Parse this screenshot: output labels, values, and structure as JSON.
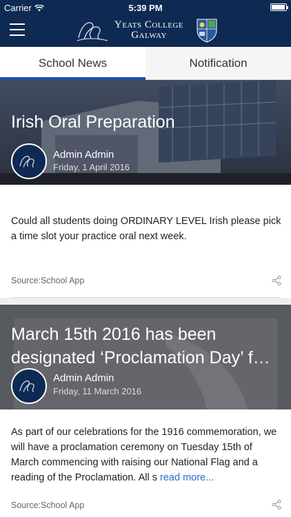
{
  "status_bar": {
    "carrier": "Carrier",
    "time": "5:39 PM"
  },
  "header": {
    "brand_line1": "Yeats College",
    "brand_line2": "Galway",
    "menu_icon": "hamburger-menu-icon",
    "colors": {
      "bar": "#0f2a52",
      "tab_indicator": "#1a4fa0",
      "link": "#2a6bd1"
    }
  },
  "tabs": [
    {
      "label": "School News",
      "active": true
    },
    {
      "label": "Notification",
      "active": false
    }
  ],
  "posts": [
    {
      "title": "Irish Oral Preparation",
      "author": "Admin Admin",
      "date": "Friday, 1 April 2016",
      "body": "Could all students doing ORDINARY LEVEL Irish please  pick a time slot your practice oral next week.",
      "read_more": "",
      "source": "Source:School App"
    },
    {
      "title": "March 15th 2016 has been designated ‘Proclamation Day’ f…",
      "author": "Admin Admin",
      "date": "Friday, 11 March 2016",
      "body": "As part of our celebrations for the 1916 commemoration, we will have a proclamation ceremony on Tuesday 15th of March commencing with raising our National Flag and a reading of the Proclamation. All s ",
      "read_more": "read more...",
      "source": "Source:School App"
    }
  ]
}
